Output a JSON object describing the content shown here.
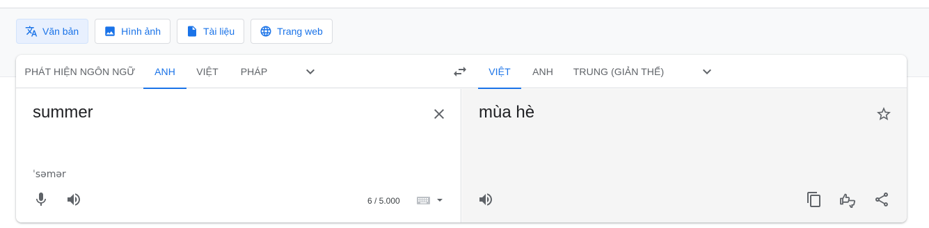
{
  "mode_buttons": [
    {
      "label": "Văn bản",
      "icon": "translate-icon",
      "active": true
    },
    {
      "label": "Hình ảnh",
      "icon": "image-icon",
      "active": false
    },
    {
      "label": "Tài liệu",
      "icon": "document-icon",
      "active": false
    },
    {
      "label": "Trang web",
      "icon": "globe-icon",
      "active": false
    }
  ],
  "source_langs": [
    "PHÁT HIỆN NGÔN NGỮ",
    "ANH",
    "VIỆT",
    "PHÁP"
  ],
  "source_active": "ANH",
  "target_langs": [
    "VIỆT",
    "ANH",
    "TRUNG (GIẢN THỂ)"
  ],
  "target_active": "VIỆT",
  "source": {
    "text": "summer",
    "phonetic": "ˈsəmər",
    "char_count": "6 / 5.000"
  },
  "target": {
    "text": "mùa hè"
  },
  "icons": {
    "swap": "swap-arrows-icon",
    "clear": "close-icon",
    "mic": "microphone-icon",
    "listen": "speaker-icon",
    "keyboard": "keyboard-icon",
    "save": "star-icon",
    "copy": "copy-icon",
    "feedback": "thumbs-feedback-icon",
    "share": "share-icon"
  },
  "colors": {
    "accent": "#1a73e8",
    "active_bg": "#e8f0fe",
    "target_pane_bg": "#f5f5f5"
  }
}
